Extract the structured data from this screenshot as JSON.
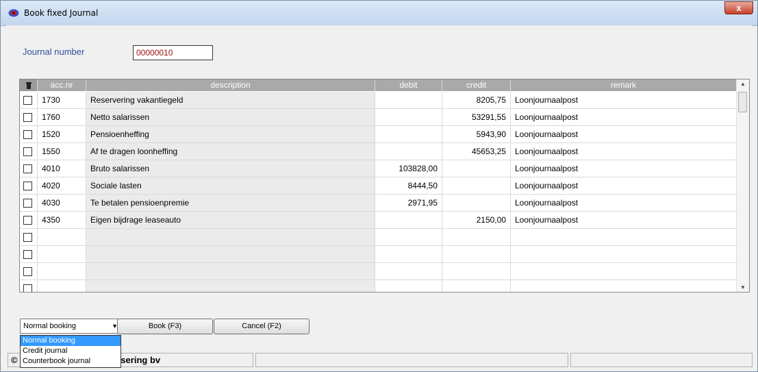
{
  "window": {
    "title": "Book fixed Journal",
    "close_label": "x"
  },
  "journal": {
    "label": "Journal number",
    "number": "00000010"
  },
  "grid": {
    "headers": [
      "acc.nr",
      "description",
      "debit",
      "credit",
      "remark"
    ],
    "rows": [
      {
        "acc": "1730",
        "desc": "Reservering vakantiegeld",
        "debit": "",
        "credit": "8205,75",
        "remark": "Loonjournaalpost"
      },
      {
        "acc": "1760",
        "desc": "Netto salarissen",
        "debit": "",
        "credit": "53291,55",
        "remark": "Loonjournaalpost"
      },
      {
        "acc": "1520",
        "desc": "Pensioenheffing",
        "debit": "",
        "credit": "5943,90",
        "remark": "Loonjournaalpost"
      },
      {
        "acc": "1550",
        "desc": "Af te dragen loonheffing",
        "debit": "",
        "credit": "45653,25",
        "remark": "Loonjournaalpost"
      },
      {
        "acc": "4010",
        "desc": "Bruto salarissen",
        "debit": "103828,00",
        "credit": "",
        "remark": "Loonjournaalpost"
      },
      {
        "acc": "4020",
        "desc": "Sociale lasten",
        "debit": "8444,50",
        "credit": "",
        "remark": "Loonjournaalpost"
      },
      {
        "acc": "4030",
        "desc": "Te betalen pensioenpremie",
        "debit": "2971,95",
        "credit": "",
        "remark": "Loonjournaalpost"
      },
      {
        "acc": "4350",
        "desc": "Eigen bijdrage leaseauto",
        "debit": "",
        "credit": "2150,00",
        "remark": "Loonjournaalpost"
      },
      {
        "acc": "",
        "desc": "",
        "debit": "",
        "credit": "",
        "remark": ""
      },
      {
        "acc": "",
        "desc": "",
        "debit": "",
        "credit": "",
        "remark": ""
      },
      {
        "acc": "",
        "desc": "",
        "debit": "",
        "credit": "",
        "remark": ""
      },
      {
        "acc": "",
        "desc": "",
        "debit": "",
        "credit": "",
        "remark": ""
      }
    ]
  },
  "booking_type": {
    "selected": "Normal booking",
    "options": [
      "Normal booking",
      "Credit journal",
      "Counterbook journal"
    ]
  },
  "buttons": {
    "book": "Book (F3)",
    "cancel": "Cancel (F2)"
  },
  "status": {
    "company": "matisering bv",
    "prefix": "©"
  }
}
